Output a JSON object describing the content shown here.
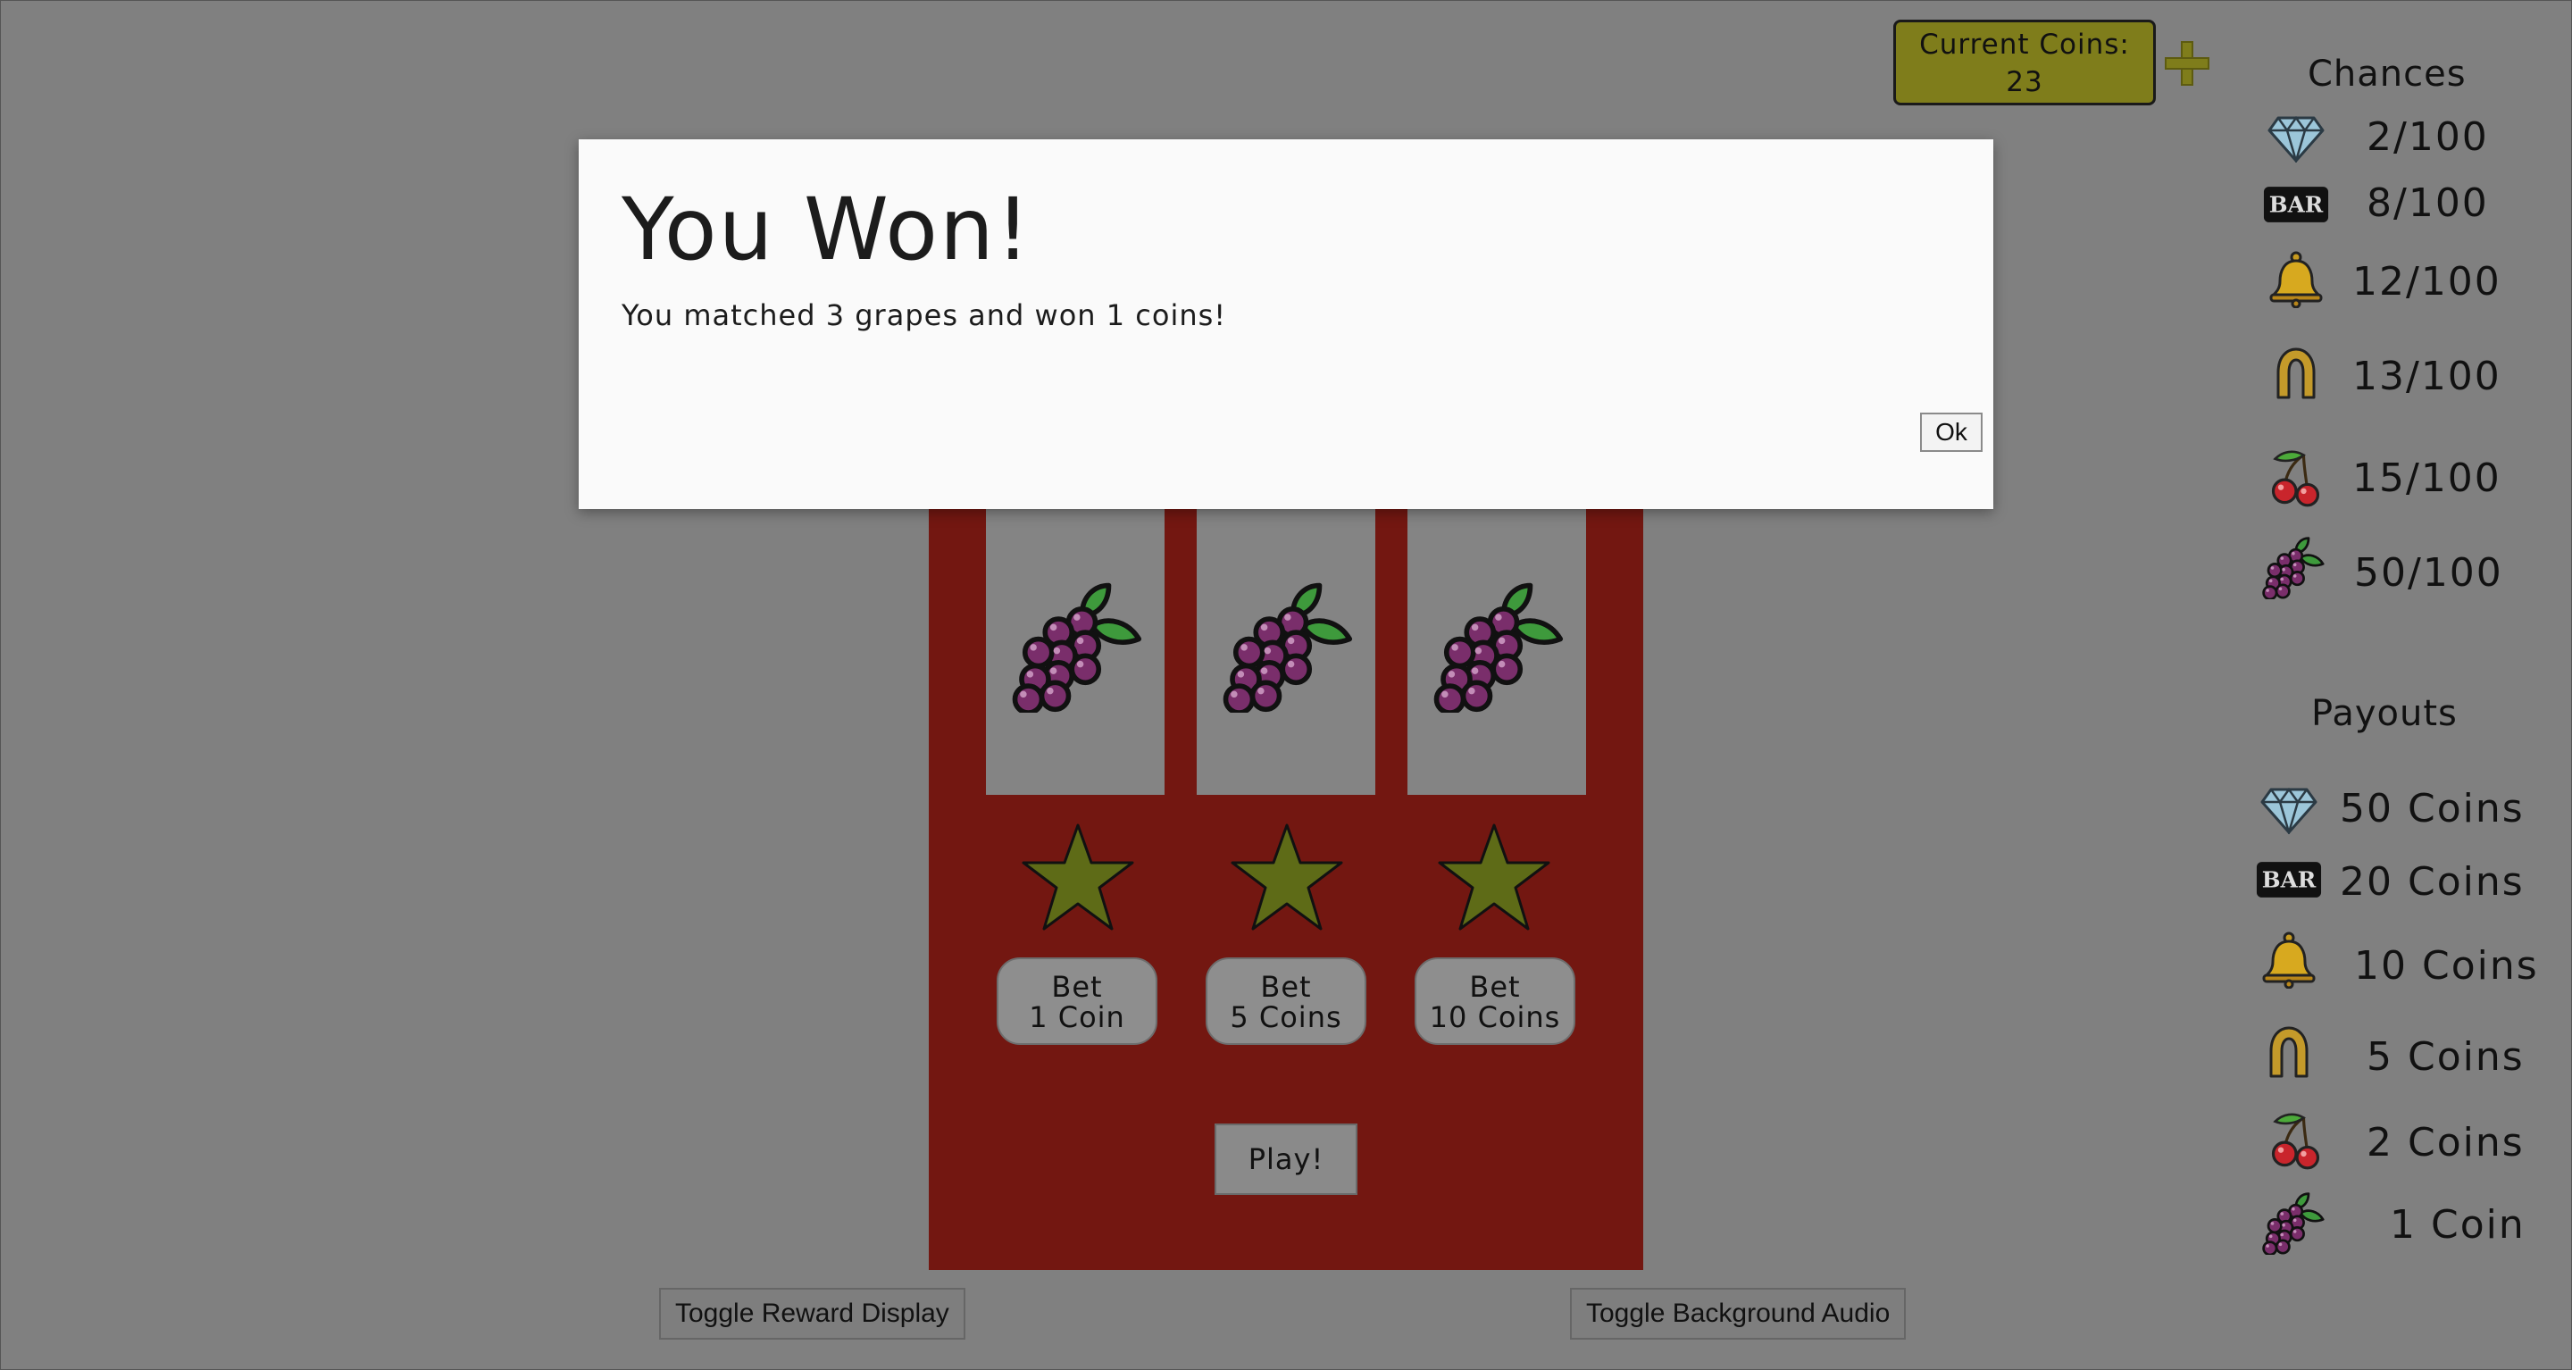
{
  "coins": {
    "label": "Current Coins:",
    "value": "23",
    "add_icon": "plus-icon"
  },
  "chances": {
    "title": "Chances",
    "rows": [
      {
        "icon": "diamond-icon",
        "text": "2/100"
      },
      {
        "icon": "bar-icon",
        "bar_text": "BAR",
        "text": "8/100"
      },
      {
        "icon": "bell-icon",
        "text": "12/100"
      },
      {
        "icon": "horseshoe-icon",
        "text": "13/100"
      },
      {
        "icon": "cherry-icon",
        "text": "15/100"
      },
      {
        "icon": "grapes-icon",
        "text": "50/100"
      }
    ]
  },
  "payouts": {
    "title": "Payouts",
    "rows": [
      {
        "icon": "diamond-icon",
        "text": "50 Coins"
      },
      {
        "icon": "bar-icon",
        "bar_text": "BAR",
        "text": "20 Coins"
      },
      {
        "icon": "bell-icon",
        "text": "10 Coins"
      },
      {
        "icon": "horseshoe-icon",
        "text": "5 Coins"
      },
      {
        "icon": "cherry-icon",
        "text": "2 Coins"
      },
      {
        "icon": "grapes-icon",
        "text": "1 Coin"
      }
    ]
  },
  "reels": [
    {
      "symbol": "grapes-icon"
    },
    {
      "symbol": "grapes-icon"
    },
    {
      "symbol": "grapes-icon"
    }
  ],
  "bets": [
    {
      "line1": "Bet",
      "line2": "1 Coin"
    },
    {
      "line1": "Bet",
      "line2": "5 Coins"
    },
    {
      "line1": "Bet",
      "line2": "10 Coins"
    }
  ],
  "play_label": "Play!",
  "toggles": {
    "reward": "Toggle Reward Display",
    "audio": "Toggle Background Audio"
  },
  "dialog": {
    "title": "You Won!",
    "message": "You matched 3 grapes and won 1 coins!",
    "ok_label": "Ok"
  },
  "colors": {
    "overlay_gray": "#808080",
    "machine_red": "#731711",
    "coin_gold": "#7f7d1b",
    "star_olive": "#5e6b17"
  }
}
